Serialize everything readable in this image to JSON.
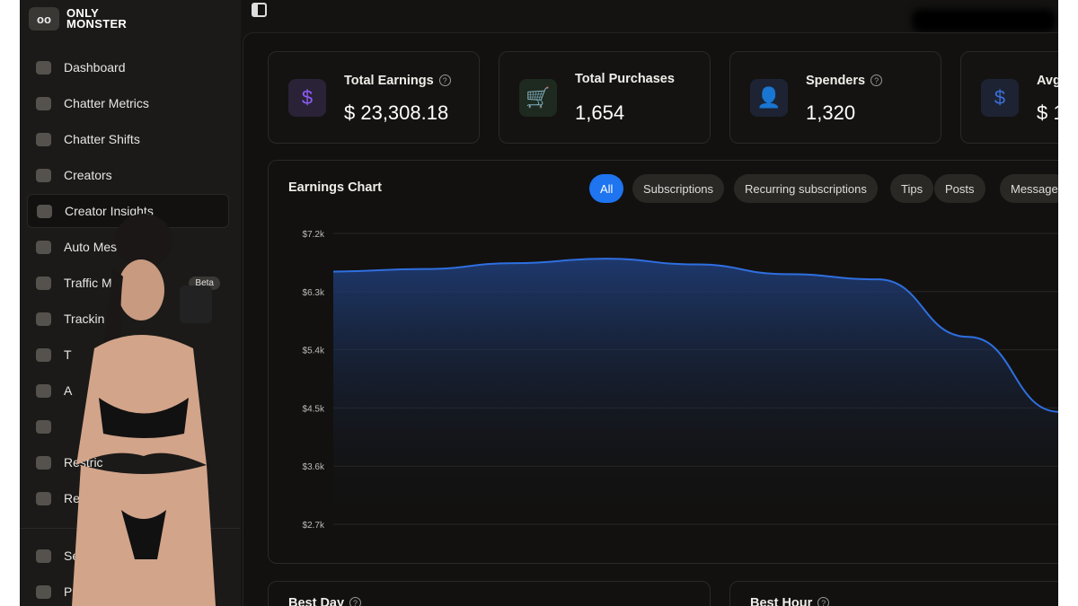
{
  "brand": {
    "line1": "ONLY",
    "line2": "MONSTER",
    "mark": "oo"
  },
  "sidebar": {
    "items": [
      {
        "label": "Dashboard",
        "icon": "home-icon"
      },
      {
        "label": "Chatter Metrics",
        "icon": "chart-icon"
      },
      {
        "label": "Chatter Shifts",
        "icon": "calendar-icon"
      },
      {
        "label": "Creators",
        "icon": "user-star-icon"
      },
      {
        "label": "Creator Insights",
        "icon": "bar-chart-icon",
        "active": true
      },
      {
        "label": "Auto Mes",
        "icon": "bolt-icon"
      },
      {
        "label": "Traffic M",
        "icon": "link-icon",
        "badge": "Beta"
      },
      {
        "label": "Trackin",
        "icon": "link-icon"
      },
      {
        "label": "T",
        "icon": "hourglass-icon"
      },
      {
        "label": "A",
        "icon": "nodes-icon"
      },
      {
        "label": "",
        "icon": "image-icon"
      },
      {
        "label": "Restric",
        "icon": "lock-icon"
      },
      {
        "label": "Ref",
        "icon": "megaphone-icon"
      }
    ],
    "bottom_items": [
      {
        "label": "Se",
        "icon": "gear-icon"
      },
      {
        "label": "Pric",
        "icon": "tag-icon"
      }
    ]
  },
  "stats": [
    {
      "label": "Total Earnings",
      "value": "$ 23,308.18",
      "help": "?",
      "icon": "$",
      "color": "#8b5cf6",
      "bg": "#2a2236"
    },
    {
      "label": "Total Purchases",
      "value": "1,654",
      "icon": "🛒",
      "color": "#4caf50",
      "bg": "#1e2a1f"
    },
    {
      "label": "Spenders",
      "value": "1,320",
      "help": "?",
      "icon": "👤",
      "color": "#3b6fd8",
      "bg": "#1d2333"
    },
    {
      "label": "Avg",
      "value": "$ 1",
      "icon": "$",
      "color": "#3b6fd8",
      "bg": "#1d2333"
    }
  ],
  "chart_section": {
    "title": "Earnings Chart",
    "filters": [
      "All",
      "Subscriptions",
      "Recurring subscriptions",
      "Tips",
      "Posts",
      "Message"
    ]
  },
  "chart_data": {
    "type": "area",
    "title": "Earnings Chart",
    "x": [
      0,
      1,
      2,
      3,
      4,
      5,
      6,
      7,
      8
    ],
    "series": [
      {
        "name": "All",
        "values": [
          6610,
          6650,
          6740,
          6810,
          6720,
          6570,
          6490,
          5600,
          4440
        ],
        "color": "#2f6fe0"
      }
    ],
    "yticks": [
      "$7.2k",
      "$6.3k",
      "$5.4k",
      "$4.5k",
      "$3.6k",
      "$2.7k"
    ],
    "ylim": [
      2700,
      7200
    ],
    "grid": true
  },
  "bottom": {
    "best_day": "Best Day",
    "best_hour": "Best Hour",
    "help": "?"
  }
}
